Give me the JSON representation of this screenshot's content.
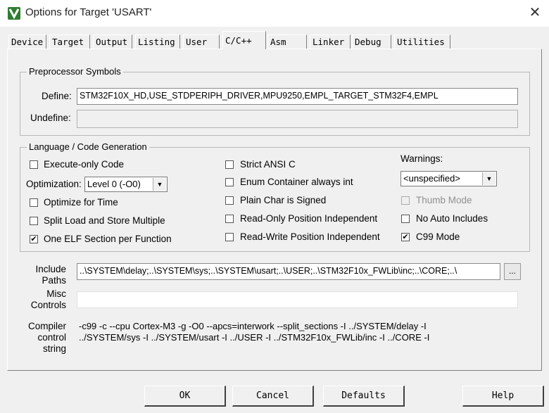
{
  "window": {
    "title": "Options for Target 'USART'",
    "close_glyph": "✕"
  },
  "tabs": [
    "Device",
    "Target",
    "Output",
    "Listing",
    "User",
    "C/C++",
    "Asm",
    "Linker",
    "Debug",
    "Utilities"
  ],
  "active_tab": "C/C++",
  "preprocessor": {
    "legend": "Preprocessor Symbols",
    "define_label": "Define:",
    "define_value": "STM32F10X_HD,USE_STDPERIPH_DRIVER,MPU9250,EMPL_TARGET_STM32F4,EMPL",
    "undefine_label": "Undefine:",
    "undefine_value": ""
  },
  "language": {
    "legend": "Language / Code Generation",
    "execute_only": {
      "label": "Execute-only Code",
      "checked": false
    },
    "optimization_label": "Optimization:",
    "optimization_value": "Level 0 (-O0)",
    "optimize_time": {
      "label": "Optimize for Time",
      "checked": false
    },
    "split_load": {
      "label": "Split Load and Store Multiple",
      "checked": false
    },
    "one_elf": {
      "label": "One ELF Section per Function",
      "checked": true
    },
    "strict_ansi": {
      "label": "Strict ANSI C",
      "checked": false
    },
    "enum_container": {
      "label": "Enum Container always int",
      "checked": false
    },
    "plain_char": {
      "label": "Plain Char is Signed",
      "checked": false
    },
    "ro_position": {
      "label": "Read-Only Position Independent",
      "checked": false
    },
    "rw_position": {
      "label": "Read-Write Position Independent",
      "checked": false
    },
    "warnings_label": "Warnings:",
    "warnings_value": "<unspecified>",
    "thumb_mode": {
      "label": "Thumb Mode",
      "checked": false,
      "disabled": true
    },
    "no_auto_includes": {
      "label": "No Auto Includes",
      "checked": false
    },
    "c99_mode": {
      "label": "C99 Mode",
      "checked": true
    }
  },
  "include_paths": {
    "label_line1": "Include",
    "label_line2": "Paths",
    "value": "..\\SYSTEM\\delay;..\\SYSTEM\\sys;..\\SYSTEM\\usart;..\\USER;..\\STM32F10x_FWLib\\inc;..\\CORE;..\\",
    "browse_label": "..."
  },
  "misc_controls": {
    "label_line1": "Misc",
    "label_line2": "Controls",
    "value": ""
  },
  "compiler_control": {
    "label_line1": "Compiler",
    "label_line2": "control",
    "label_line3": "string",
    "line1": "-c99 -c --cpu Cortex-M3 -g -O0 --apcs=interwork --split_sections -I ../SYSTEM/delay -I",
    "line2": "../SYSTEM/sys -I ../SYSTEM/usart -I ../USER -I ../STM32F10x_FWLib/inc -I ../CORE -I"
  },
  "buttons": {
    "ok": "OK",
    "cancel": "Cancel",
    "defaults": "Defaults",
    "help": "Help"
  },
  "check_glyph": "✔",
  "dropdown_glyph": "▼"
}
